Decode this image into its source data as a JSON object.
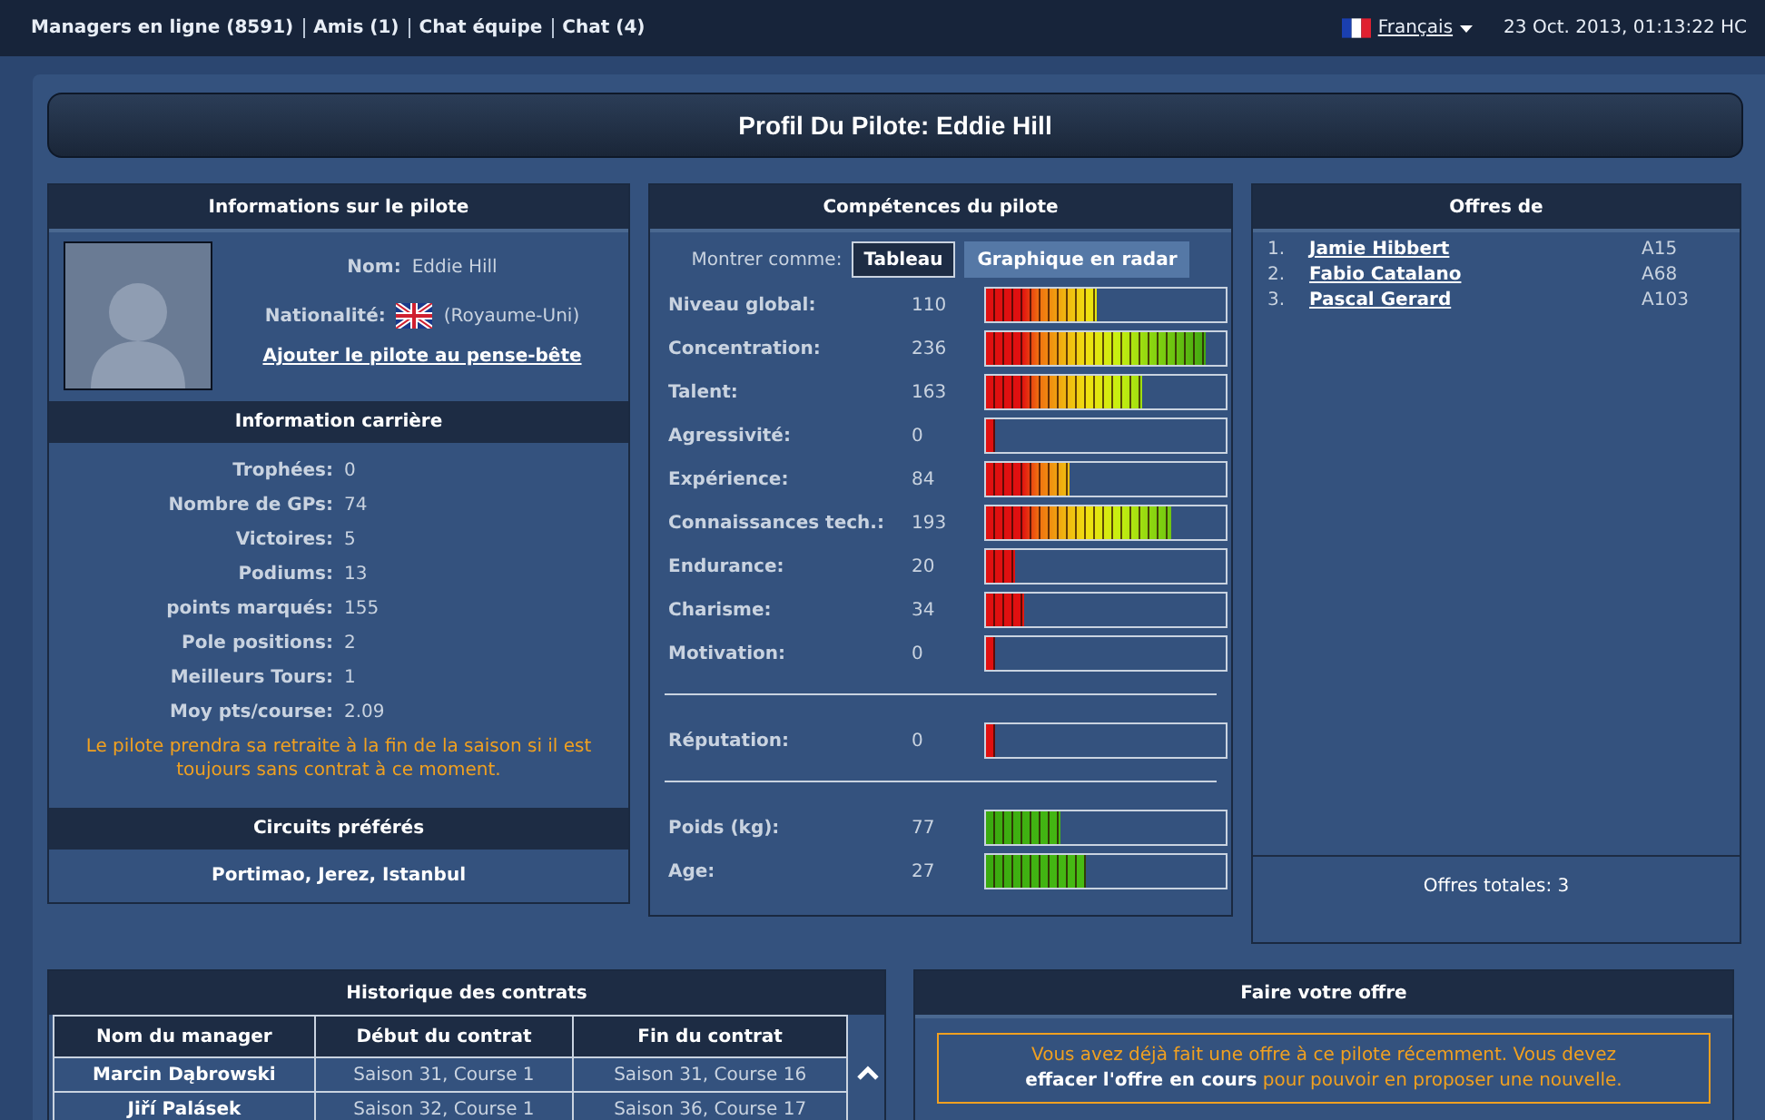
{
  "top_bar": {
    "links": [
      {
        "label": "Managers en ligne (8591)"
      },
      {
        "label": "Amis (1)"
      },
      {
        "label": "Chat équipe"
      },
      {
        "label": "Chat (4)"
      }
    ],
    "language": "Français",
    "datetime": "23 Oct. 2013, 01:13:22 HC"
  },
  "page_title": "Profil Du Pilote: Eddie Hill",
  "driver_info": {
    "title": "Informations sur le pilote",
    "name_label": "Nom:",
    "name": "Eddie Hill",
    "nationality_label": "Nationalité:",
    "nationality": "(Royaume-Uni)",
    "watchlist_link": "Ajouter le pilote au pense-bête"
  },
  "career": {
    "title": "Information carrière",
    "stats": [
      {
        "label": "Trophées:",
        "value": "0"
      },
      {
        "label": "Nombre de GPs:",
        "value": "74"
      },
      {
        "label": "Victoires:",
        "value": "5"
      },
      {
        "label": "Podiums:",
        "value": "13"
      },
      {
        "label": "points marqués:",
        "value": "155"
      },
      {
        "label": "Pole positions:",
        "value": "2"
      },
      {
        "label": "Meilleurs Tours:",
        "value": "1"
      },
      {
        "label": "Moy pts/course:",
        "value": "2.09"
      }
    ],
    "notice": "Le pilote prendra sa retraite à la fin de la saison si il est toujours sans contrat à ce moment."
  },
  "favorite_tracks": {
    "title": "Circuits préférés",
    "tracks": "Portimao, Jerez, Istanbul"
  },
  "skills": {
    "title": "Compétences du pilote",
    "view_label": "Montrer comme:",
    "views": [
      {
        "label": "Tableau",
        "selected": true
      },
      {
        "label": "Graphique en radar",
        "selected": false
      }
    ],
    "groups": [
      [
        {
          "label": "Niveau global:",
          "value": "110",
          "level": 0.46,
          "kind": "skill"
        },
        {
          "label": "Concentration:",
          "value": "236",
          "level": 0.92,
          "kind": "skill"
        },
        {
          "label": "Talent:",
          "value": "163",
          "level": 0.65,
          "kind": "skill"
        },
        {
          "label": "Agressivité:",
          "value": "0",
          "level": 0.04,
          "kind": "skill"
        },
        {
          "label": "Expérience:",
          "value": "84",
          "level": 0.35,
          "kind": "skill"
        },
        {
          "label": "Connaissances tech.:",
          "value": "193",
          "level": 0.77,
          "kind": "skill"
        },
        {
          "label": "Endurance:",
          "value": "20",
          "level": 0.12,
          "kind": "skill"
        },
        {
          "label": "Charisme:",
          "value": "34",
          "level": 0.16,
          "kind": "skill"
        },
        {
          "label": "Motivation:",
          "value": "0",
          "level": 0.04,
          "kind": "skill"
        }
      ],
      [
        {
          "label": "Réputation:",
          "value": "0",
          "level": 0.04,
          "kind": "skill"
        }
      ],
      [
        {
          "label": "Poids (kg):",
          "value": "77",
          "level": 0.31,
          "kind": "physical"
        },
        {
          "label": "Age:",
          "value": "27",
          "level": 0.42,
          "kind": "physical"
        }
      ]
    ]
  },
  "offers": {
    "title": "Offres de",
    "items": [
      {
        "rank": "1.",
        "manager": "Jamie Hibbert",
        "league": "A15"
      },
      {
        "rank": "2.",
        "manager": "Fabio Catalano",
        "league": "A68"
      },
      {
        "rank": "3.",
        "manager": "Pascal Gerard",
        "league": "A103"
      }
    ],
    "total": "Offres totales: 3"
  },
  "contracts": {
    "title": "Historique des contrats",
    "columns": [
      "Nom du manager",
      "Début du contrat",
      "Fin du contrat"
    ],
    "rows": [
      [
        "Marcin Dąbrowski",
        "Saison 31, Course 1",
        "Saison 31, Course 16"
      ],
      [
        "Jiří Palásek",
        "Saison 32, Course 1",
        "Saison 36, Course 17"
      ]
    ]
  },
  "make_offer": {
    "title": "Faire votre offre",
    "notice": "Vous avez déjà fait une offre à ce pilote récemment. Vous devez **effacer l'offre en cours** pour pouvoir en proposer une nouvelle."
  }
}
